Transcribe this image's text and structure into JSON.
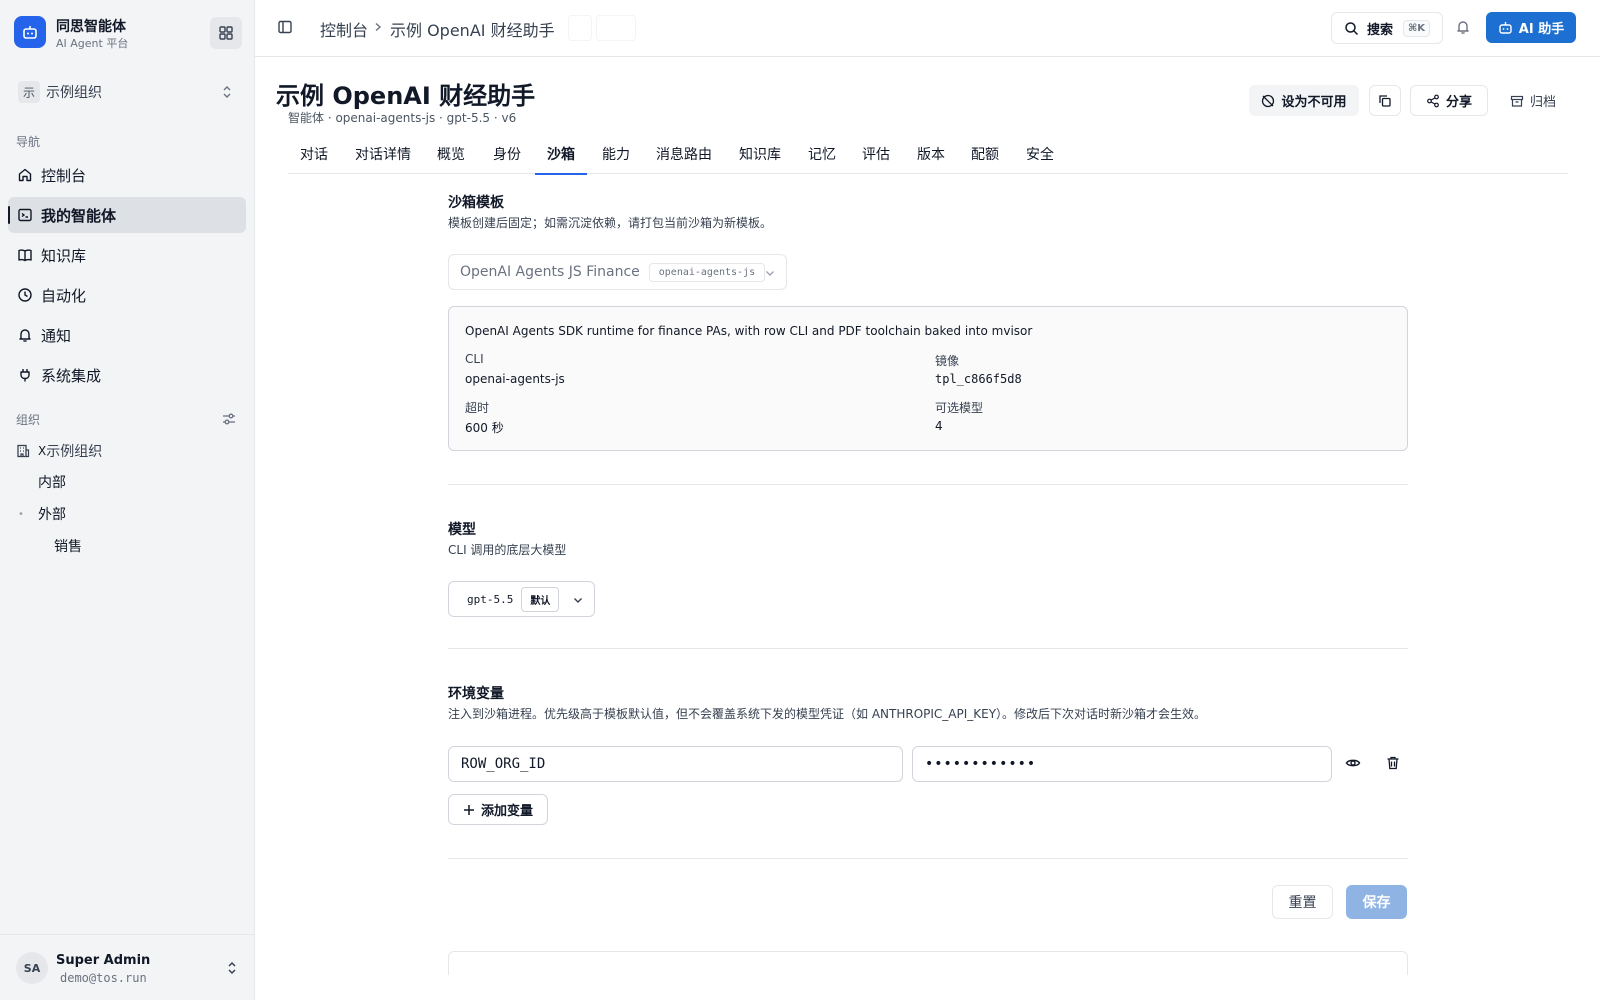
{
  "brand": {
    "title": "同思智能体",
    "subtitle": "AI Agent 平台"
  },
  "org_switcher": {
    "chip": "示",
    "name": "示例组织"
  },
  "nav": {
    "section_label": "导航",
    "items": [
      {
        "label": "控制台",
        "icon": "home-icon"
      },
      {
        "label": "我的智能体",
        "icon": "agent-icon",
        "active": true
      },
      {
        "label": "知识库",
        "icon": "book-icon"
      },
      {
        "label": "自动化",
        "icon": "clock-icon"
      },
      {
        "label": "通知",
        "icon": "bell-icon"
      },
      {
        "label": "系统集成",
        "icon": "plug-icon"
      }
    ]
  },
  "org_tree": {
    "section_label": "组织",
    "root": "示例组织",
    "root_prefix": "X",
    "children": [
      "内部",
      "外部"
    ],
    "grandchildren": [
      "销售"
    ]
  },
  "user": {
    "initials": "SA",
    "name": "Super Admin",
    "email": "demo@tos.run"
  },
  "topbar": {
    "breadcrumb_home": "控制台",
    "breadcrumb_current": "示例 OpenAI 财经助手",
    "search_label": "搜索",
    "search_shortcut": "⌘K",
    "ai_button": "AI 助手"
  },
  "header": {
    "title": "示例 OpenAI 财经助手",
    "subtitle": "智能体 · openai-agents-js · gpt-5.5 · v6",
    "disable_button": "设为不可用",
    "share_button": "分享",
    "archive_button": "归档"
  },
  "tabs": [
    "对话",
    "对话详情",
    "概览",
    "身份",
    "沙箱",
    "能力",
    "消息路由",
    "知识库",
    "记忆",
    "评估",
    "版本",
    "配额",
    "安全"
  ],
  "active_tab": "沙箱",
  "sandbox_template": {
    "title": "沙箱模板",
    "description": "模板创建后固定；如需沉淀依赖，请打包当前沙箱为新模板。",
    "selected": "OpenAI Agents JS Finance",
    "selected_tag": "openai-agents-js",
    "card": {
      "description": "OpenAI Agents SDK runtime for finance PAs, with row CLI and PDF toolchain baked into mvisor",
      "cli_label": "CLI",
      "cli_value": "openai-agents-js",
      "image_label": "镜像",
      "image_value": "tpl_c866f5d8",
      "timeout_label": "超时",
      "timeout_value": "600 秒",
      "models_label": "可选模型",
      "models_value": "4"
    }
  },
  "model": {
    "title": "模型",
    "description": "CLI 调用的底层大模型",
    "selected": "gpt-5.5",
    "tag": "默认"
  },
  "env": {
    "title": "环境变量",
    "description": "注入到沙箱进程。优先级高于模板默认值，但不会覆盖系统下发的模型凭证（如 ANTHROPIC_API_KEY）。修改后下次对话时新沙箱才会生效。",
    "vars": [
      {
        "key": "ROW_ORG_ID",
        "value_masked": "••••••••••••"
      }
    ],
    "add_button": "添加变量"
  },
  "actions": {
    "reset": "重置",
    "save": "保存"
  },
  "colors": {
    "primary": "#1d6fd1",
    "accent": "#2563eb",
    "save_disabled": "#8fb4e3"
  }
}
